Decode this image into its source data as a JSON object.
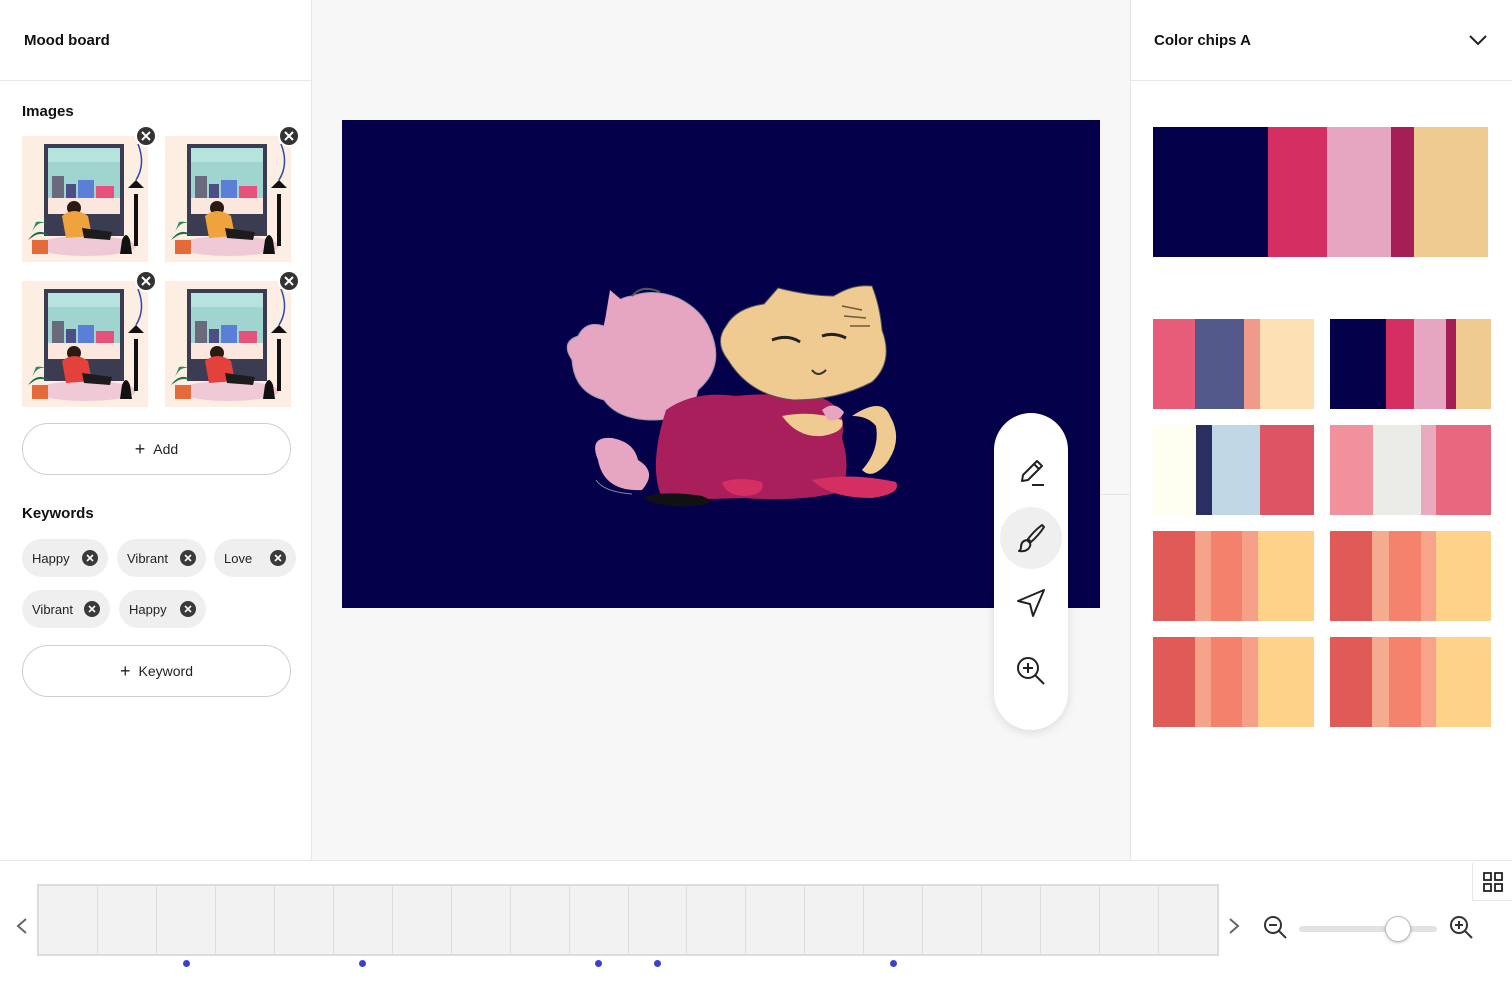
{
  "left_panel": {
    "title": "Mood board",
    "images_title": "Images",
    "images": [
      {
        "name": "illustration-thumb-1"
      },
      {
        "name": "illustration-thumb-2"
      },
      {
        "name": "illustration-thumb-3"
      },
      {
        "name": "illustration-thumb-4"
      }
    ],
    "add_label": "Add",
    "keywords_title": "Keywords",
    "keywords": [
      "Happy",
      "Vibrant",
      "Love",
      "Vibrant",
      "Happy"
    ],
    "add_keyword_label": "Keyword"
  },
  "canvas": {
    "background": "#05004a",
    "tools": [
      {
        "icon": "pen-icon",
        "active": false
      },
      {
        "icon": "brush-icon",
        "active": true
      },
      {
        "icon": "send-icon",
        "active": false
      },
      {
        "icon": "zoom-in-icon",
        "active": false
      }
    ]
  },
  "right_panel": {
    "title": "Color chips A",
    "dropdown_icon": "chevron-down-icon",
    "main_palette": [
      {
        "color": "#05004a",
        "weight": 115
      },
      {
        "color": "#d52e62",
        "weight": 59
      },
      {
        "color": "#e6a5c0",
        "weight": 64
      },
      {
        "color": "#a51f56",
        "weight": 23
      },
      {
        "color": "#efca91",
        "weight": 74
      }
    ],
    "palettes": [
      [
        {
          "color": "#e85c7a",
          "weight": 42
        },
        {
          "color": "#535a8b",
          "weight": 49
        },
        {
          "color": "#f09b8a",
          "weight": 16
        },
        {
          "color": "#fde0b3",
          "weight": 54
        }
      ],
      [
        {
          "color": "#05004a",
          "weight": 56
        },
        {
          "color": "#d52e62",
          "weight": 28
        },
        {
          "color": "#e6a5c0",
          "weight": 32
        },
        {
          "color": "#a51f56",
          "weight": 10
        },
        {
          "color": "#efca91",
          "weight": 35
        }
      ],
      [
        {
          "color": "#fefff0",
          "weight": 43
        },
        {
          "color": "#2a2f61",
          "weight": 16
        },
        {
          "color": "#c0d8e6",
          "weight": 48
        },
        {
          "color": "#dd5465",
          "weight": 54
        }
      ],
      [
        {
          "color": "#f1919b",
          "weight": 43
        },
        {
          "color": "#ebebe8",
          "weight": 48
        },
        {
          "color": "#e9a9bf",
          "weight": 15
        },
        {
          "color": "#ea6780",
          "weight": 55
        }
      ],
      [
        {
          "color": "#e05a58",
          "weight": 42
        },
        {
          "color": "#f5a38a",
          "weight": 16
        },
        {
          "color": "#f4816b",
          "weight": 31
        },
        {
          "color": "#f6a08a",
          "weight": 16
        },
        {
          "color": "#ffd28a",
          "weight": 56
        }
      ],
      [
        {
          "color": "#e05a58",
          "weight": 42
        },
        {
          "color": "#f5ab8f",
          "weight": 17
        },
        {
          "color": "#f4826c",
          "weight": 32
        },
        {
          "color": "#f7a48b",
          "weight": 15
        },
        {
          "color": "#ffd28a",
          "weight": 55
        }
      ],
      [
        {
          "color": "#e05a58",
          "weight": 42
        },
        {
          "color": "#f5a38a",
          "weight": 16
        },
        {
          "color": "#f4816b",
          "weight": 31
        },
        {
          "color": "#f6a08a",
          "weight": 16
        },
        {
          "color": "#ffd28a",
          "weight": 56
        }
      ],
      [
        {
          "color": "#e05a58",
          "weight": 42
        },
        {
          "color": "#f5ab8f",
          "weight": 17
        },
        {
          "color": "#f4826c",
          "weight": 32
        },
        {
          "color": "#f7a48b",
          "weight": 15
        },
        {
          "color": "#ffd28a",
          "weight": 55
        }
      ]
    ]
  },
  "timeline": {
    "frame_count": 20,
    "marked_frames": [
      2,
      5,
      9,
      10,
      14
    ],
    "marker_color": "#3b3fd1",
    "zoom_level": 0.72
  }
}
